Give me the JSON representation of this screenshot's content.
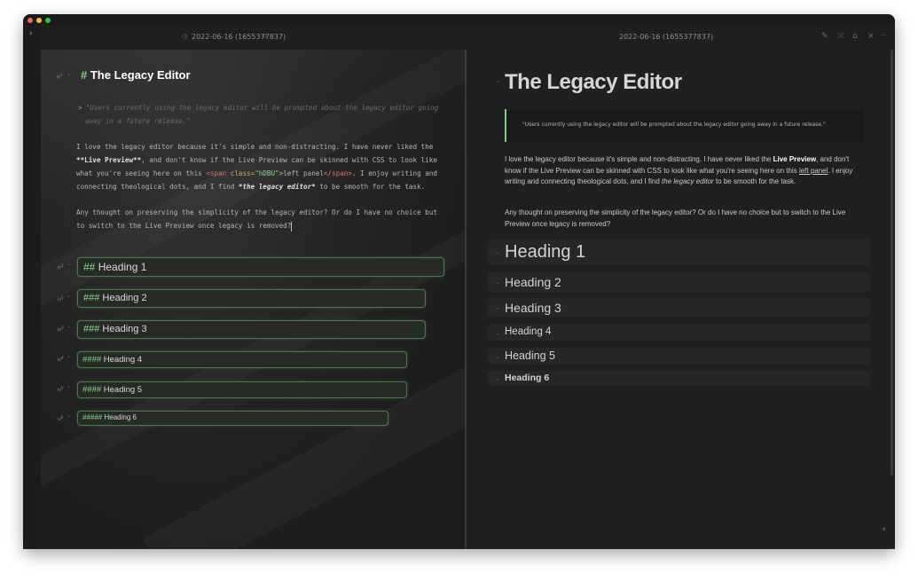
{
  "window": {
    "left_tab_title": "2022-06-16 (1655377837)",
    "right_tab_title": "2022-06-16 (1655377837)"
  },
  "icons": {
    "expand_sidebar": "›",
    "edit": "✎",
    "unlink": "⤫",
    "pin": "⌂",
    "close": "×",
    "more": "···",
    "collapse": "‹",
    "fold": "⌄",
    "heading_marker": "H"
  },
  "source": {
    "h1": {
      "hash": "#",
      "text": "The Legacy Editor"
    },
    "quote_marker": ">",
    "quote_line1": "\"Users currently using the legacy editor will be prompted about the legacy editor going",
    "quote_line2": "away in a future release.\"",
    "p1_l1": "I love the legacy editor because it's simple and non-distracting. I have never liked the",
    "p1_l2_a": "**Live Preview**",
    "p1_l2_b": ", and don't know if the Live Preview can be skinned with CSS to look like",
    "p1_l3_a": "what you're seeing here on this ",
    "p1_l3_tag_open": "<span",
    "p1_l3_attr": " class=",
    "p1_l3_str": "\"hDBU\"",
    "p1_l3_gt": ">",
    "p1_l3_text": "left panel",
    "p1_l3_tag_close": "</span>",
    "p1_l3_b": ". I enjoy writing and",
    "p1_l4_a": "connecting theological dots, and I find ",
    "p1_l4_em": "*the legacy editor*",
    "p1_l4_b": " to be smooth for the task.",
    "p2_l1": "Any thought on preserving the simplicity of the legacy editor? Or do I have no choice but",
    "p2_l2": "to switch to the Live Preview once legacy is removed?",
    "headings": [
      {
        "hash": "##",
        "text": "Heading 1"
      },
      {
        "hash": "###",
        "text": "Heading 2"
      },
      {
        "hash": "###",
        "text": "Heading 3"
      },
      {
        "hash": "####",
        "text": "Heading 4"
      },
      {
        "hash": "####",
        "text": "Heading 5"
      },
      {
        "hash": "#####",
        "text": "Heading 6"
      }
    ]
  },
  "preview": {
    "title": "The Legacy Editor",
    "quote": "\"Users currently using the legacy editor will be prompted about the legacy editor going away in a future release.\"",
    "p1_a": "I love the legacy editor because it's simple and non-distracting. I have never liked the ",
    "p1_bold": "Live Preview",
    "p1_b": ", and don't know if the Live Preview can be skinned with CSS to look like what you're seeing here on this ",
    "p1_u": "left panel",
    "p1_c": ". I enjoy writing and connecting theological dots, and I find ",
    "p1_em": "the legacy editor",
    "p1_d": " to be smooth for the task.",
    "p2": "Any thought on preserving the simplicity of the legacy editor? Or do I have no choice but to switch to the Live Preview once legacy is removed?",
    "headings": [
      "Heading 1",
      "Heading 2",
      "Heading 3",
      "Heading 4",
      "Heading 5",
      "Heading 6"
    ]
  },
  "colors": {
    "accent_green": "#7dd87d",
    "background": "#1f1f1f",
    "tag_red": "#e07070",
    "attr_orange": "#d4a85a"
  }
}
